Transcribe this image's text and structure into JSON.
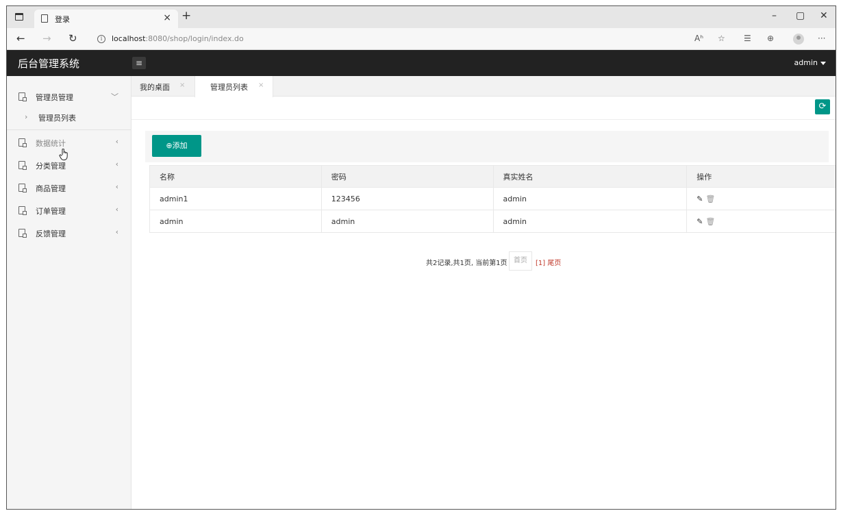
{
  "browser": {
    "tab_title": "登录",
    "tab_close": "×",
    "new_tab": "+",
    "url_host": "localhost",
    "url_rest": ":8080/shop/login/index.do",
    "minimize": "–",
    "maximize": "▢",
    "close": "✕",
    "back": "←",
    "forward": "→",
    "reload": "↻",
    "info": "i",
    "read_aloud": "Aʰ",
    "fav": "☆",
    "favorites": "☰",
    "collections": "⊕",
    "more": "···"
  },
  "app": {
    "logo": "后台管理系统",
    "menu_toggle": "≡",
    "user": "admin"
  },
  "sidebar": {
    "items": [
      {
        "label": "管理员管理",
        "chevron": "﹀"
      },
      {
        "label": "数据统计",
        "chevron": "‹"
      },
      {
        "label": "分类管理",
        "chevron": "‹"
      },
      {
        "label": "商品管理",
        "chevron": "‹"
      },
      {
        "label": "订单管理",
        "chevron": "‹"
      },
      {
        "label": "反馈管理",
        "chevron": "‹"
      }
    ],
    "sub_item": {
      "arrow": "›",
      "label": "管理员列表"
    }
  },
  "content": {
    "tabs": [
      {
        "label": "我的桌面",
        "close": "×"
      },
      {
        "label": "管理员列表",
        "close": "×"
      }
    ],
    "refresh": "⟳",
    "add_icon": "⊕",
    "add_label": "添加",
    "table": {
      "headers": [
        "名称",
        "密码",
        "真实姓名",
        "操作"
      ],
      "rows": [
        [
          "admin1",
          "123456",
          "admin"
        ],
        [
          "admin",
          "admin",
          "admin"
        ]
      ],
      "edit_icon": "✎",
      "delete_icon": "🗑"
    },
    "pager": {
      "summary": "共2记录,共1页, 当前第1页",
      "first": "首页",
      "current": "[1] 尾页"
    }
  },
  "colors": {
    "accent": "#009688",
    "header": "#222222",
    "pager_current": "#c0392b"
  }
}
